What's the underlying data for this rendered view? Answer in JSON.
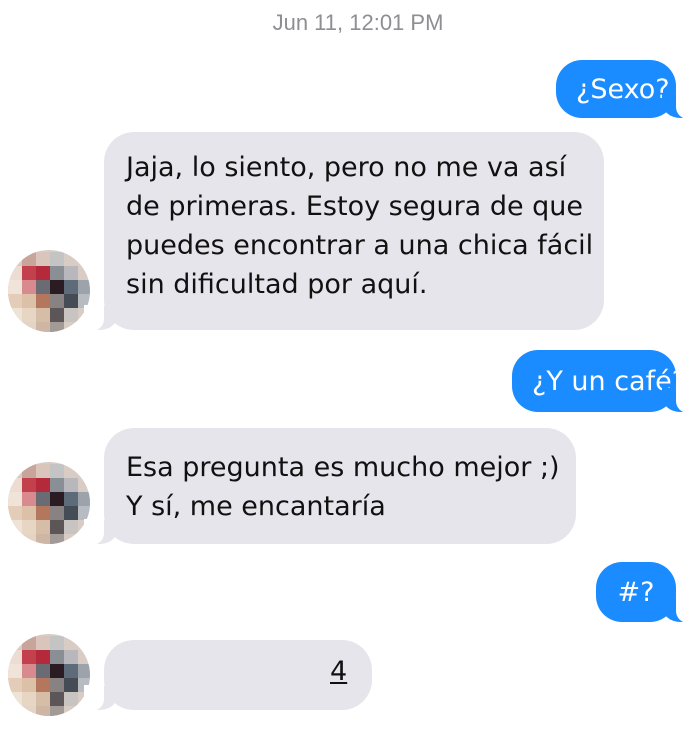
{
  "conversation": {
    "timestamp": "Jun 11, 12:01 PM",
    "messages": [
      {
        "direction": "outgoing",
        "lines": [
          "¿Sexo?"
        ]
      },
      {
        "direction": "incoming",
        "lines": [
          "Jaja, lo siento, pero no me va así",
          "de primeras. Estoy segura de que",
          "puedes encontrar a una chica fácil",
          "sin dificultad por aquí."
        ]
      },
      {
        "direction": "outgoing",
        "lines": [
          "¿Y un café?"
        ]
      },
      {
        "direction": "incoming",
        "lines": [
          "Esa pregunta es mucho mejor ;)",
          "Y sí, me encantaría"
        ]
      },
      {
        "direction": "outgoing",
        "lines": [
          "#?"
        ]
      },
      {
        "direction": "incoming",
        "lines": [
          "4"
        ]
      }
    ]
  },
  "colors": {
    "outgoing_bubble": "#1a8cff",
    "incoming_bubble": "#e6e5eb",
    "timestamp_text": "#8e8e93"
  },
  "avatar": {
    "style": "pixelated-censored"
  }
}
